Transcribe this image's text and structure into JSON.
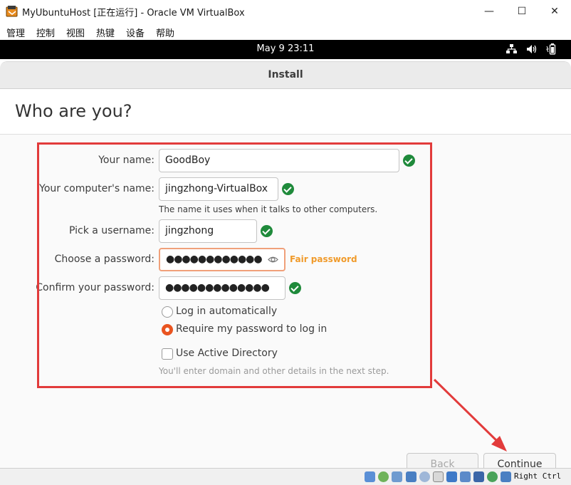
{
  "host_window": {
    "title": "MyUbuntuHost [正在运行] - Oracle VM VirtualBox",
    "controls": {
      "minimize": "—",
      "maximize": "☐",
      "close": "✕"
    }
  },
  "menu": [
    "管理",
    "控制",
    "视图",
    "热键",
    "设备",
    "帮助"
  ],
  "guest_topbar": {
    "clock": "May 9  23:11",
    "tray_icons": [
      "network-icon",
      "volume-icon",
      "battery-icon"
    ]
  },
  "installer": {
    "window_title": "Install",
    "page_title": "Who are you?",
    "fields": {
      "name": {
        "label": "Your name:",
        "value": "GoodBoy"
      },
      "computer": {
        "label": "Your computer's name:",
        "value": "jingzhong-VirtualBox",
        "hint": "The name it uses when it talks to other computers."
      },
      "username": {
        "label": "Pick a username:",
        "value": "jingzhong"
      },
      "password": {
        "label": "Choose a password:",
        "value": "●●●●●●●●●●●●",
        "strength": "Fair password"
      },
      "confirm": {
        "label": "Confirm your password:",
        "value": "●●●●●●●●●●●●●"
      }
    },
    "login_options": {
      "auto": "Log in automatically",
      "require": "Require my password to log in",
      "selected": "require"
    },
    "active_directory": {
      "label": "Use Active Directory",
      "checked": false,
      "hint": "You'll enter domain and other details in the next step."
    },
    "buttons": {
      "back": "Back",
      "continue": "Continue"
    }
  },
  "statusbar": {
    "host_key": "Right Ctrl",
    "icons": [
      "disk-icon",
      "optical-icon",
      "audio-icon",
      "network-icon",
      "usb-icon",
      "shared-folder-icon",
      "display-icon",
      "recording-icon",
      "cpu-icon",
      "mouse-icon",
      "keyboard-icon"
    ]
  },
  "colors": {
    "highlight": "#e23b3b",
    "accent": "#e95420",
    "valid": "#1f8a3b",
    "strength": "#f09a2a"
  }
}
